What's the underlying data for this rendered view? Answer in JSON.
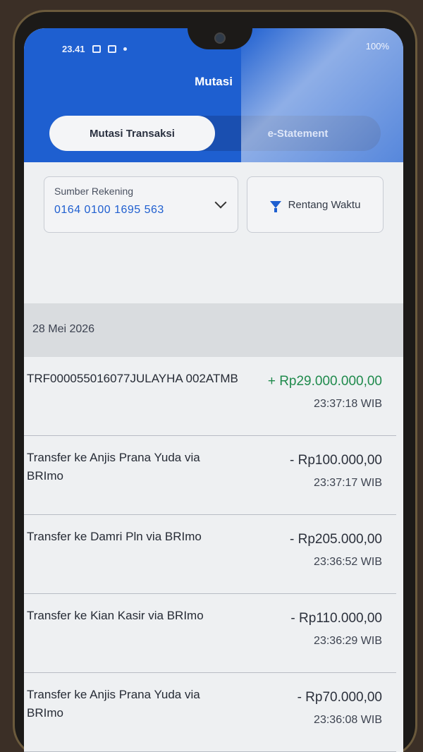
{
  "status": {
    "time": "23.41",
    "battery": "100%"
  },
  "title": "Mutasi",
  "tabs": [
    {
      "label": "Mutasi Transaksi",
      "active": true
    },
    {
      "label": "e-Statement",
      "active": false
    }
  ],
  "account": {
    "label": "Sumber Rekening",
    "number": "0164 0100 1695 563"
  },
  "range_label": "Rentang Waktu",
  "date": "28 Mei 2026",
  "transactions": [
    {
      "desc": "TRF000055016077JULAYHA 002ATMB",
      "amount": "+ Rp29.000.000,00",
      "time": "23:37:18 WIB",
      "type": "credit"
    },
    {
      "desc": "Transfer ke Anjis Prana Yuda via BRImo",
      "amount": "- Rp100.000,00",
      "time": "23:37:17 WIB",
      "type": "debit"
    },
    {
      "desc": "Transfer ke Damri Pln via BRImo",
      "amount": "- Rp205.000,00",
      "time": "23:36:52 WIB",
      "type": "debit"
    },
    {
      "desc": "Transfer ke Kian Kasir via BRImo",
      "amount": "- Rp110.000,00",
      "time": "23:36:29 WIB",
      "type": "debit"
    },
    {
      "desc": "Transfer ke Anjis Prana Yuda via BRImo",
      "amount": "- Rp70.000,00",
      "time": "23:36:08 WIB",
      "type": "debit"
    }
  ],
  "colors": {
    "primary": "#1e5fd0",
    "credit": "#1f8a4c"
  }
}
